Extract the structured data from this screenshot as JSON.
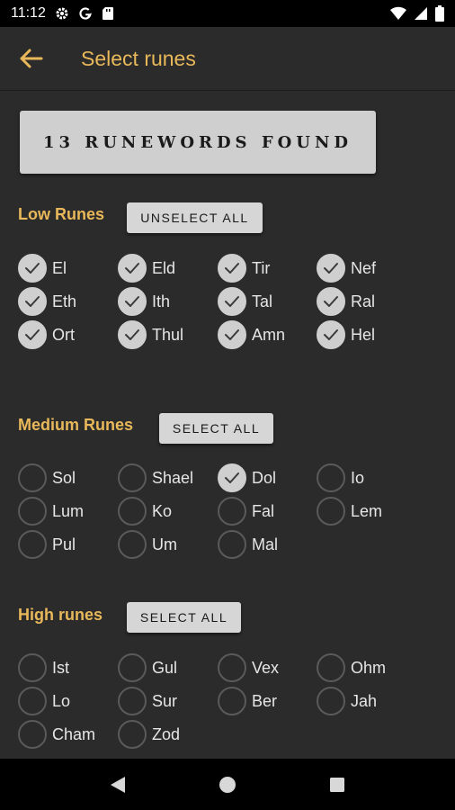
{
  "status_bar": {
    "time": "11:12"
  },
  "app_bar": {
    "title": "Select runes"
  },
  "banner": {
    "text": "13 RUNEWORDS FOUND"
  },
  "sections": {
    "low": {
      "title": "Low Runes",
      "button": "UNSELECT ALL",
      "runes": [
        {
          "label": "El",
          "checked": true
        },
        {
          "label": "Eld",
          "checked": true
        },
        {
          "label": "Tir",
          "checked": true
        },
        {
          "label": "Nef",
          "checked": true
        },
        {
          "label": "Eth",
          "checked": true
        },
        {
          "label": "Ith",
          "checked": true
        },
        {
          "label": "Tal",
          "checked": true
        },
        {
          "label": "Ral",
          "checked": true
        },
        {
          "label": "Ort",
          "checked": true
        },
        {
          "label": "Thul",
          "checked": true
        },
        {
          "label": "Amn",
          "checked": true
        },
        {
          "label": "Hel",
          "checked": true
        }
      ]
    },
    "medium": {
      "title": "Medium Runes",
      "button": "SELECT ALL",
      "runes": [
        {
          "label": "Sol",
          "checked": false
        },
        {
          "label": "Shael",
          "checked": false
        },
        {
          "label": "Dol",
          "checked": true
        },
        {
          "label": "Io",
          "checked": false
        },
        {
          "label": "Lum",
          "checked": false
        },
        {
          "label": "Ko",
          "checked": false
        },
        {
          "label": "Fal",
          "checked": false
        },
        {
          "label": "Lem",
          "checked": false
        },
        {
          "label": "Pul",
          "checked": false
        },
        {
          "label": "Um",
          "checked": false
        },
        {
          "label": "Mal",
          "checked": false
        }
      ]
    },
    "high": {
      "title": "High runes",
      "button": "SELECT ALL",
      "runes": [
        {
          "label": "Ist",
          "checked": false
        },
        {
          "label": "Gul",
          "checked": false
        },
        {
          "label": "Vex",
          "checked": false
        },
        {
          "label": "Ohm",
          "checked": false
        },
        {
          "label": "Lo",
          "checked": false
        },
        {
          "label": "Sur",
          "checked": false
        },
        {
          "label": "Ber",
          "checked": false
        },
        {
          "label": "Jah",
          "checked": false
        },
        {
          "label": "Cham",
          "checked": false
        },
        {
          "label": "Zod",
          "checked": false
        }
      ]
    }
  },
  "colors": {
    "accent": "#e8b85a",
    "background": "#2b2b2b",
    "button_bg": "#d6d6d6"
  }
}
